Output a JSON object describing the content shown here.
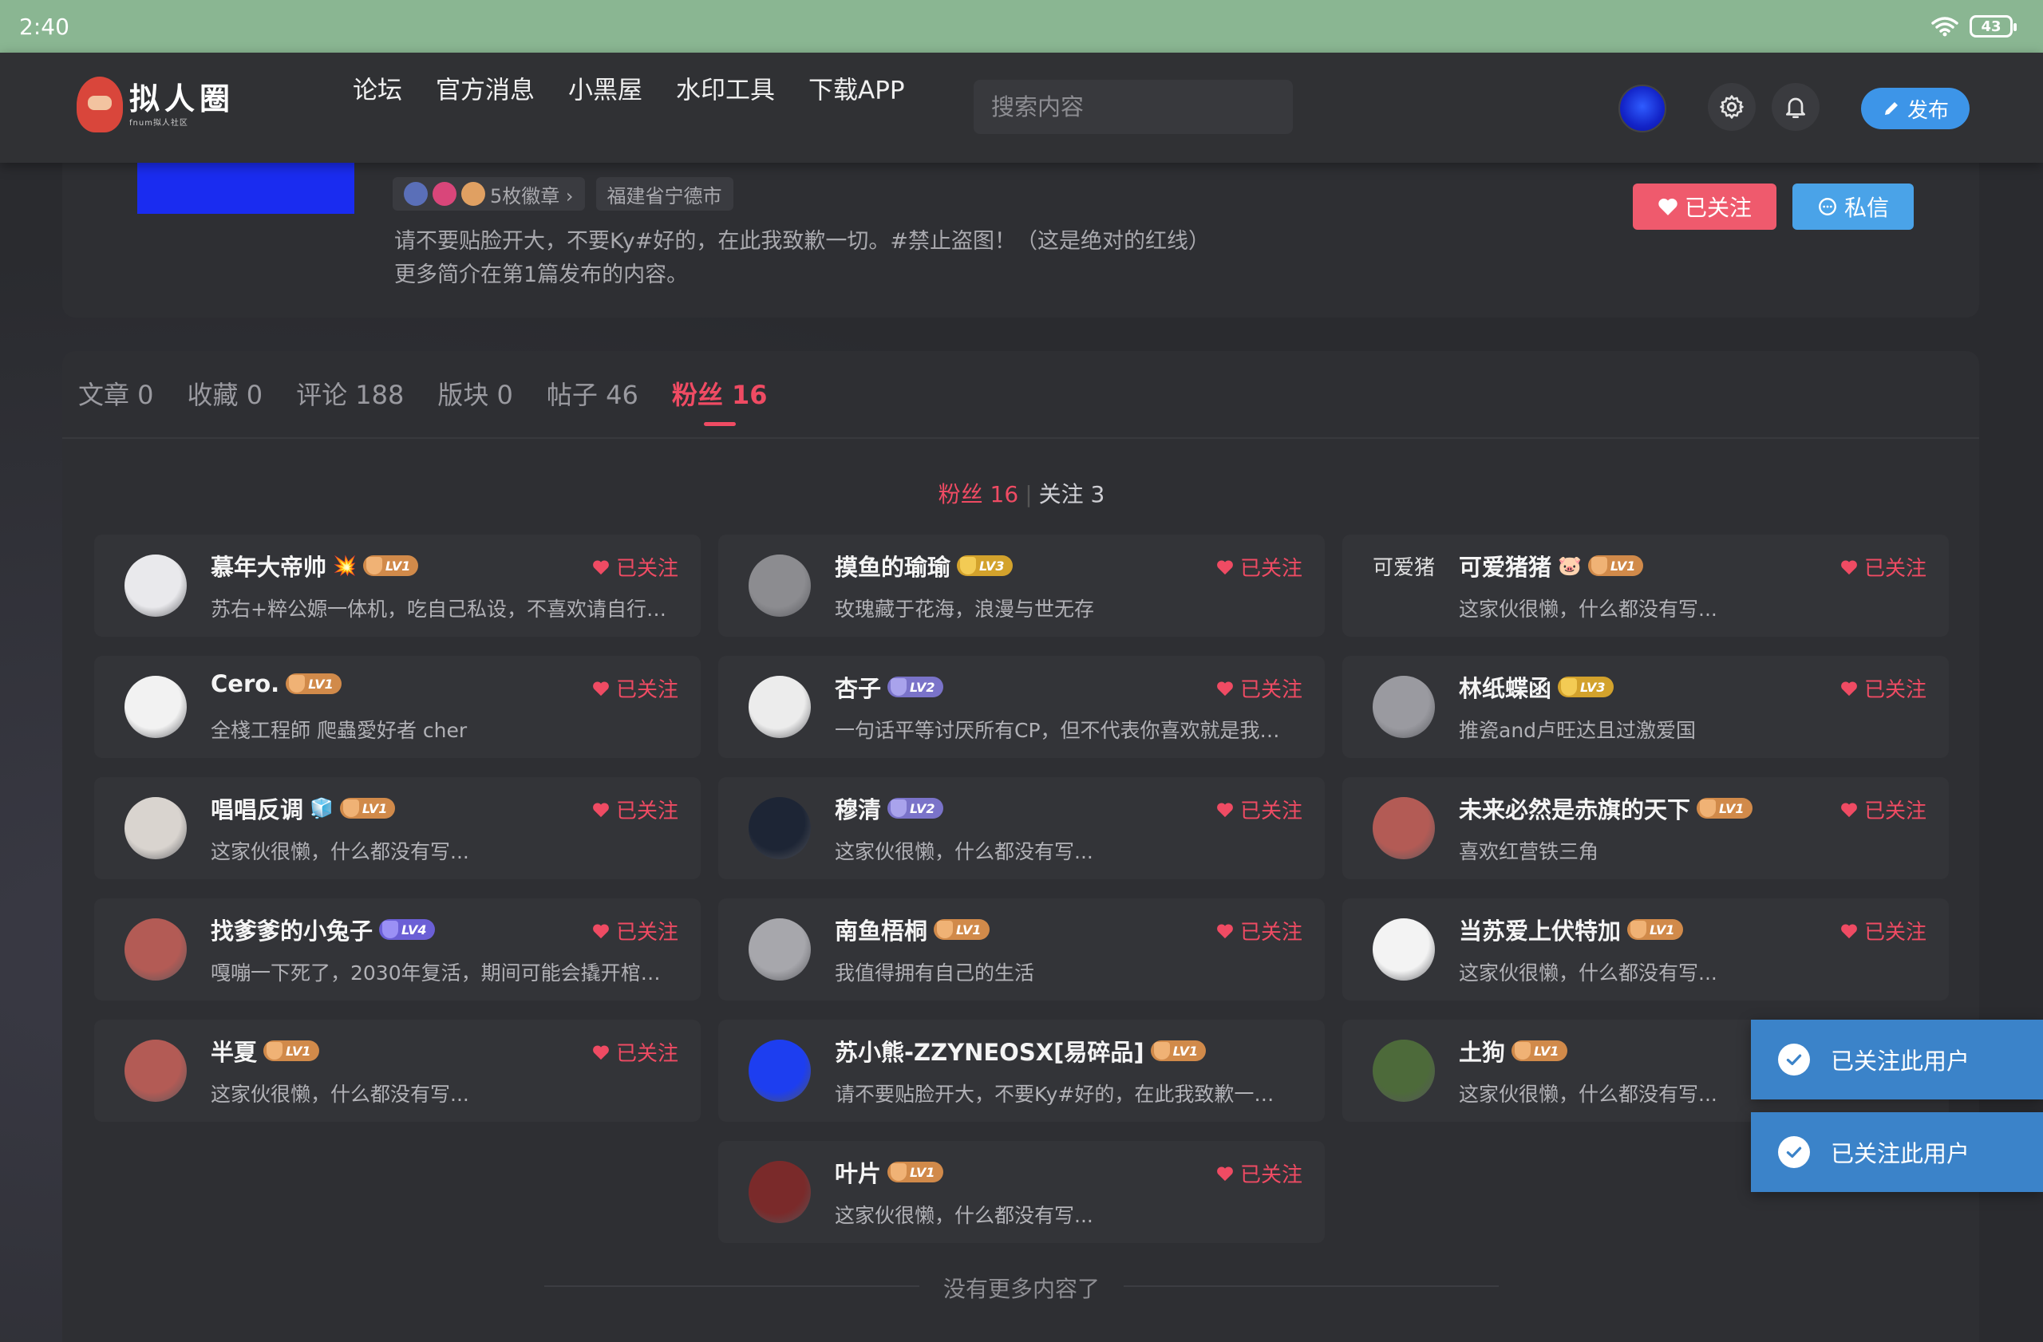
{
  "status": {
    "time": "2:40",
    "battery": "43"
  },
  "nav": {
    "logo_title": "拟人圈",
    "logo_sub": "fnum拟人社区",
    "links": [
      "论坛",
      "官方消息",
      "小黑屋",
      "水印工具",
      "下载APP"
    ],
    "search_placeholder": "搜索内容",
    "publish": "发布"
  },
  "profile": {
    "badges_label": "5枚徽章 ›",
    "location": "福建省宁德市",
    "bio": "请不要贴脸开大，不要Ky#好的，在此我致歉一切。#禁止盗图！（这是绝对的红线）更多简介在第1篇发布的内容。",
    "followed_btn": "已关注",
    "message_btn": "私信"
  },
  "tabs": [
    {
      "label": "文章 0",
      "active": false
    },
    {
      "label": "收藏 0",
      "active": false
    },
    {
      "label": "评论 188",
      "active": false
    },
    {
      "label": "版块 0",
      "active": false
    },
    {
      "label": "帖子 46",
      "active": false
    },
    {
      "label": "粉丝 16",
      "active": true
    }
  ],
  "subswitch": {
    "fans": "粉丝 16",
    "separator": "|",
    "following": "关注 3"
  },
  "follow_label": "已关注",
  "fans": [
    {
      "name": "慕年大帝帅",
      "emoji": "💥",
      "level": "LV1",
      "bio": "苏右+粹公嫄一体机，吃自己私设，不喜欢请自行…",
      "followed": true,
      "avatar_color": "#e9e9ec"
    },
    {
      "name": "摸鱼的瑜瑜",
      "level": "LV3",
      "bio": "玫瑰藏于花海，浪漫与世无存",
      "followed": true,
      "avatar_color": "#8c8c90"
    },
    {
      "name": "可爱猪猪",
      "emoji": "🐷",
      "level": "LV1",
      "bio": "这家伙很懒，什么都没有写...",
      "followed": true,
      "avatar_alt": "可爱猪",
      "avatar_color": "#333438"
    },
    {
      "name": "Cero.",
      "level": "LV1",
      "bio": "全棧工程師 爬蟲愛好者 cher",
      "followed": true,
      "avatar_color": "#f2f2f2"
    },
    {
      "name": "杏子",
      "level": "LV2",
      "bio": "一句话平等讨厌所有CP，但不代表你喜欢就是我…",
      "followed": true,
      "avatar_color": "#ececec"
    },
    {
      "name": "林纸蝶函",
      "level": "LV3",
      "bio": "推瓷and卢旺达且过激爱国",
      "followed": true,
      "avatar_color": "#9a9aa0"
    },
    {
      "name": "唱唱反调",
      "emoji": "🧊",
      "level": "LV1",
      "bio": "这家伙很懒，什么都没有写...",
      "followed": true,
      "avatar_color": "#d9d4cf"
    },
    {
      "name": "穆清",
      "level": "LV2",
      "bio": "这家伙很懒，什么都没有写...",
      "followed": true,
      "avatar_color": "#1d2535"
    },
    {
      "name": "未来必然是赤旗的天下",
      "level": "LV1",
      "bio": "喜欢红营铁三角",
      "followed": true,
      "avatar_color": "#b35b55"
    },
    {
      "name": "找爹爹的小兔子",
      "level": "LV4",
      "bio": "嘎嘣一下死了，2030年复活，期间可能会撬开棺…",
      "followed": true,
      "avatar_color": "#b35b55"
    },
    {
      "name": "南鱼梧桐",
      "level": "LV1",
      "bio": "我值得拥有自己的生活",
      "followed": true,
      "avatar_color": "#a7a7ac"
    },
    {
      "name": "当苏爱上伏特加",
      "level": "LV1",
      "bio": "这家伙很懒，什么都没有写...",
      "followed": true,
      "avatar_color": "#f3f3f3"
    },
    {
      "name": "半夏",
      "level": "LV1",
      "bio": "这家伙很懒，什么都没有写...",
      "followed": true,
      "avatar_color": "#b35b55"
    },
    {
      "name": "苏小熊-ZZYNEOSX[易碎品]",
      "level": "LV1",
      "bio": "请不要贴脸开大，不要Ky#好的，在此我致歉一…",
      "followed": false,
      "avatar_color": "#1d3ef0"
    },
    {
      "name": "土狗",
      "level": "LV1",
      "bio": "这家伙很懒，什么都没有写...",
      "followed": false,
      "avatar_color": "#4d6a3a"
    },
    {
      "name": "叶片",
      "level": "LV1",
      "bio": "这家伙很懒，什么都没有写...",
      "followed": true,
      "avatar_color": "#7a2a2a"
    }
  ],
  "no_more": "没有更多内容了",
  "toasts": [
    "已关注此用户",
    "已关注此用户"
  ],
  "colors": {
    "accent": "#ef4b63",
    "toast": "#3b83c9",
    "statusbar": "#8ab692"
  }
}
